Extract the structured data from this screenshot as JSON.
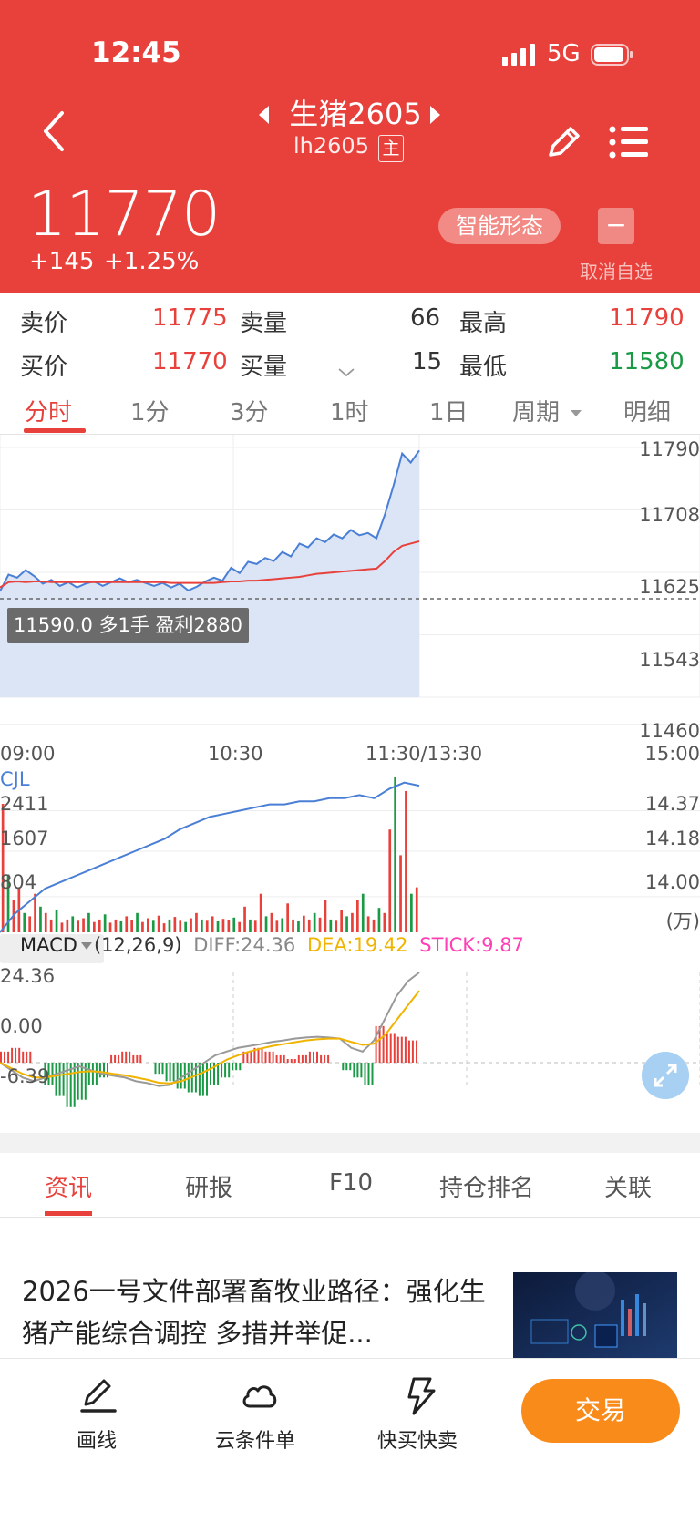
{
  "status_bar": {
    "time": "12:45",
    "network": "5G"
  },
  "header": {
    "title": "生猪2605",
    "code": "lh2605",
    "main_badge": "主",
    "price": "11770",
    "change": "+145",
    "change_pct": "+1.25%",
    "smart_button": "智能形态",
    "minus_symbol": "−",
    "unwatch_label": "取消自选"
  },
  "quote": {
    "ask_label": "卖价",
    "ask": "11775",
    "ask_vol_label": "卖量",
    "ask_vol": "66",
    "high_label": "最高",
    "high": "11790",
    "bid_label": "买价",
    "bid": "11770",
    "bid_vol_label": "买量",
    "bid_vol": "15",
    "low_label": "最低",
    "low": "11580"
  },
  "tabs": [
    "分时",
    "1分",
    "3分",
    "1时",
    "1日",
    "周期",
    "明细"
  ],
  "active_tab": "分时",
  "chart_labels": {
    "price_ticks": [
      "11790",
      "11708",
      "11625",
      "11543",
      "11460"
    ],
    "time_ticks": [
      "09:00",
      "10:30",
      "11:30/13:30",
      "15:00"
    ],
    "position_tip": "11590.0 多1手 盈利2880",
    "volume_title": "CJL",
    "volume_ticks_left": [
      "2411",
      "1607",
      "804"
    ],
    "volume_ticks_right": [
      "14.37",
      "14.18",
      "14.00"
    ],
    "volume_unit": "(万)",
    "macd_name": "MACD",
    "macd_params": "(12,26,9)",
    "macd_diff": "DIFF:24.36",
    "macd_dea": "DEA:19.42",
    "macd_stick": "STICK:9.87",
    "macd_ticks": [
      "24.36",
      "0.00",
      "-6.39"
    ]
  },
  "chart_data": {
    "type": "line",
    "price": {
      "ylim": [
        11460,
        11790
      ],
      "x_fraction_of_day_range": [
        0,
        1
      ],
      "series": [
        {
          "values": [
            11600,
            11622,
            11618,
            11628,
            11620,
            11610,
            11615,
            11607,
            11612,
            11605,
            11610,
            11613,
            11607,
            11612,
            11617,
            11612,
            11615,
            11611,
            11607,
            11611,
            11605,
            11610,
            11601,
            11606,
            11613,
            11618,
            11614,
            11631,
            11624,
            11639,
            11636,
            11644,
            11640,
            11652,
            11646,
            11663,
            11658,
            11670,
            11665,
            11675,
            11670,
            11681,
            11674,
            11677,
            11670,
            11702,
            11740,
            11782,
            11770,
            11786
          ]
        },
        {
          "values": [
            11605,
            11612,
            11613,
            11612,
            11613,
            11613,
            11612,
            11612,
            11612,
            11612,
            11612,
            11612,
            11612,
            11612,
            11612,
            11612,
            11612,
            11612,
            11612,
            11612,
            11611,
            11611,
            11611,
            11611,
            11611,
            11611,
            11612,
            11613,
            11613,
            11614,
            11614,
            11615,
            11616,
            11617,
            11618,
            11619,
            11621,
            11623,
            11624,
            11625,
            11626,
            11627,
            11628,
            11629,
            11630,
            11640,
            11652,
            11660,
            11663,
            11666
          ]
        }
      ]
    },
    "volume": {
      "ylim_left": [
        0,
        2411
      ],
      "bars": [
        2000,
        900,
        500,
        700,
        300,
        250,
        600,
        400,
        300,
        200,
        350,
        150,
        200,
        250,
        180,
        220,
        300,
        160,
        200,
        280,
        150,
        200,
        170,
        250,
        190,
        300,
        160,
        220,
        180,
        260,
        140,
        200,
        240,
        180,
        160,
        220,
        300,
        200,
        180,
        250,
        170,
        210,
        190,
        230,
        160,
        400,
        200,
        180,
        600,
        250,
        300,
        180,
        220,
        450,
        200,
        170,
        260,
        200,
        300,
        230,
        500,
        200,
        180,
        350,
        250,
        300,
        500,
        600,
        250,
        200,
        380,
        300,
        1600,
        2411,
        1200,
        2200,
        600,
        700
      ],
      "oi_line_right": {
        "ylim": [
          13.9,
          14.42
        ],
        "values": [
          13.9,
          13.96,
          14.0,
          14.04,
          14.06,
          14.08,
          14.1,
          14.12,
          14.14,
          14.16,
          14.18,
          14.2,
          14.23,
          14.25,
          14.27,
          14.28,
          14.29,
          14.3,
          14.31,
          14.31,
          14.32,
          14.32,
          14.33,
          14.33,
          14.34,
          14.33,
          14.36,
          14.38,
          14.37
        ]
      }
    },
    "macd": {
      "ylim": [
        -6.39,
        24.36
      ],
      "diff": [
        0,
        -2,
        -4,
        -5,
        -4,
        -3,
        -2,
        -1,
        -2,
        -3,
        -3.5,
        -4,
        -5,
        -5.5,
        -6.3,
        -6,
        -4,
        -2,
        0,
        2,
        3,
        4,
        4.5,
        5,
        5.6,
        6,
        6.5,
        6.8,
        7,
        6.8,
        6.5,
        4,
        3,
        6,
        12,
        18,
        22,
        24.36
      ],
      "dea": [
        0,
        -1.5,
        -3,
        -4,
        -4,
        -3.5,
        -3,
        -2.5,
        -2.3,
        -2.5,
        -3,
        -3.4,
        -4,
        -4.6,
        -5.4,
        -5.6,
        -5,
        -3.8,
        -2.5,
        -1,
        0.8,
        2,
        3,
        3.8,
        4.5,
        5,
        5.5,
        6,
        6.3,
        6.5,
        6.5,
        5.6,
        4.8,
        5.1,
        7.5,
        11.5,
        15.5,
        19.42
      ],
      "stick": [
        3,
        4,
        3,
        0,
        -6,
        -9,
        -12,
        -10,
        -6,
        -4,
        2,
        3,
        2,
        0,
        -3,
        -5,
        -7,
        -8,
        -9,
        -6,
        -4,
        -2,
        3,
        4,
        3,
        2,
        1,
        2,
        3,
        2,
        0,
        -2,
        -4,
        -6,
        9.87,
        8,
        7,
        6
      ]
    }
  },
  "news_tabs": [
    "资讯",
    "研报",
    "F10",
    "持仓排名",
    "关联"
  ],
  "active_news_tab": "资讯",
  "news": [
    {
      "title": "2026一号文件部署畜牧业路径：强化生猪产能综合调控 多措并举促..."
    }
  ],
  "bottom_bar": {
    "draw_label": "画线",
    "cloud_label": "云条件单",
    "quick_label": "快买快卖",
    "trade_label": "交易"
  },
  "colors": {
    "brand_red": "#e8413c",
    "down_green": "#1a9a45",
    "price_line": "#4a7fd6",
    "avg_line": "#e8413c",
    "trade_orange": "#f98b1b"
  }
}
